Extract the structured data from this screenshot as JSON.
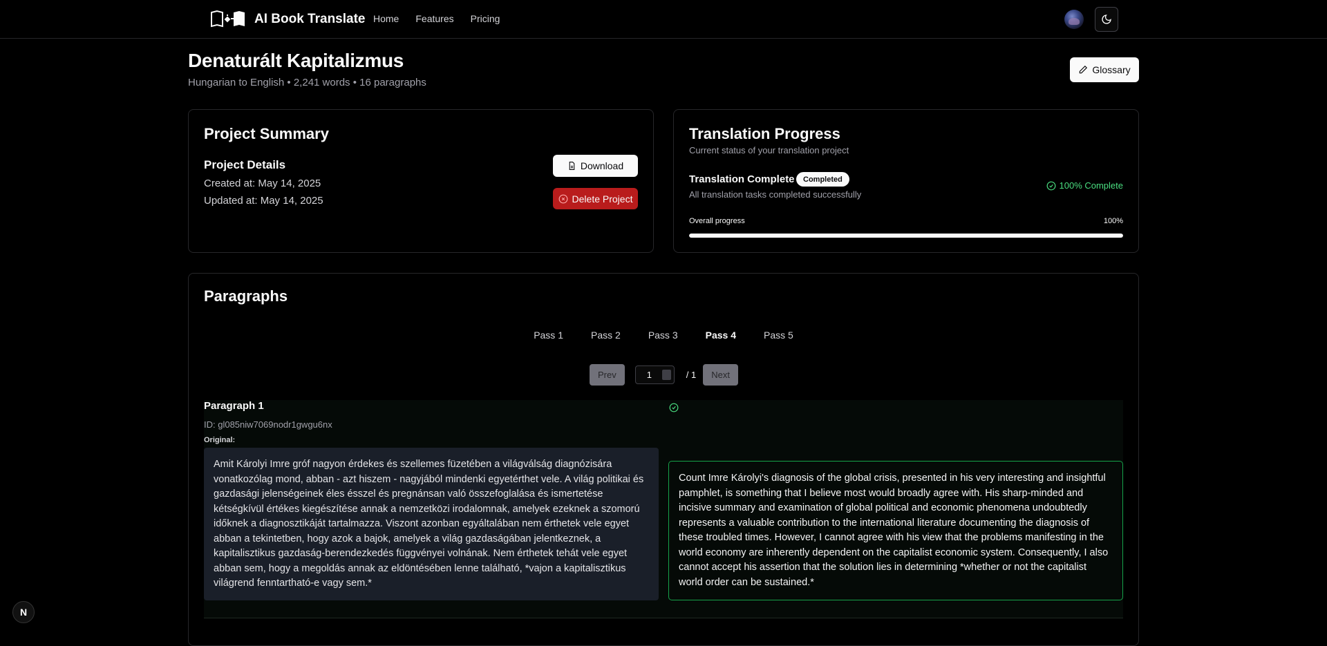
{
  "header": {
    "brand": "AI Book Translate",
    "nav": [
      "Home",
      "Features",
      "Pricing"
    ]
  },
  "project": {
    "title": "Denaturált Kapitalizmus",
    "subtitle": "Hungarian to English • 2,241 words • 16 paragraphs",
    "glossary_label": "Glossary"
  },
  "summary": {
    "title": "Project Summary",
    "details_title": "Project Details",
    "created": "Created at: May 14, 2025",
    "updated": "Updated at: May 14, 2025",
    "download_label": "Download",
    "delete_label": "Delete Project"
  },
  "progress": {
    "title": "Translation Progress",
    "subtitle": "Current status of your translation project",
    "status_label": "Translation Complete",
    "badge": "Completed",
    "status_desc": "All translation tasks completed successfully",
    "complete_text": "100% Complete",
    "overall_label": "Overall progress",
    "overall_value": "100%",
    "fraction": 1.0
  },
  "paragraphs": {
    "title": "Paragraphs",
    "tabs": [
      "Pass 1",
      "Pass 2",
      "Pass 3",
      "Pass 4",
      "Pass 5"
    ],
    "active_tab": "Pass 4",
    "pager": {
      "prev": "Prev",
      "next": "Next",
      "current": "1",
      "total": "/ 1"
    },
    "items": [
      {
        "title": "Paragraph 1",
        "id": "ID: gl085niw7069nodr1gwgu6nx",
        "original_label": "Original:",
        "original": "Amit Károlyi Imre gróf nagyon érdekes és szellemes füzetében a világválság diagnózisára vonatkozólag mond, abban - azt hiszem - nagyjából mindenki egyetérthet vele. A világ politikai és gazdasági jelenségeinek éles ésszel és pregnánsan való összefoglalása és ismertetése kétségkívül értékes kiegészítése annak a nemzetközi irodalomnak, amelyek ezeknek a szomorú időknek a diagnosztikáját tartalmazza. Viszont azonban egyáltalában nem érthetek vele egyet abban a tekintetben, hogy azok a bajok, amelyek a világ gazdaságában jelentkeznek, a kapitalisztikus gazdaság-berendezkedés függvényei volnának. Nem érthetek tehát vele egyet abban sem, hogy a megoldás annak az eldöntésében lenne található, *vajon a kapitalisztikus világrend fenntartható-e vagy sem.*",
        "translation": "Count Imre Károlyi's diagnosis of the global crisis, presented in his very interesting and insightful pamphlet, is something that I believe most would broadly agree with. His sharp-minded and incisive summary and examination of global political and economic phenomena undoubtedly represents a valuable contribution to the international literature documenting the diagnosis of these troubled times. However, I cannot agree with his view that the problems manifesting in the world economy are inherently dependent on the capitalist economic system. Consequently, I also cannot accept his assertion that the solution lies in determining *whether or not the capitalist world order can be sustained.*"
      }
    ]
  },
  "colors": {
    "accent_green": "#4ade80",
    "danger": "#b91c1c",
    "background": "#000000"
  },
  "icons": [
    "brand-logo-icon",
    "moon-icon",
    "pencil-icon",
    "file-icon",
    "x-circle-icon",
    "check-circle-icon",
    "spinner-icon"
  ],
  "devtools_badge": "N"
}
